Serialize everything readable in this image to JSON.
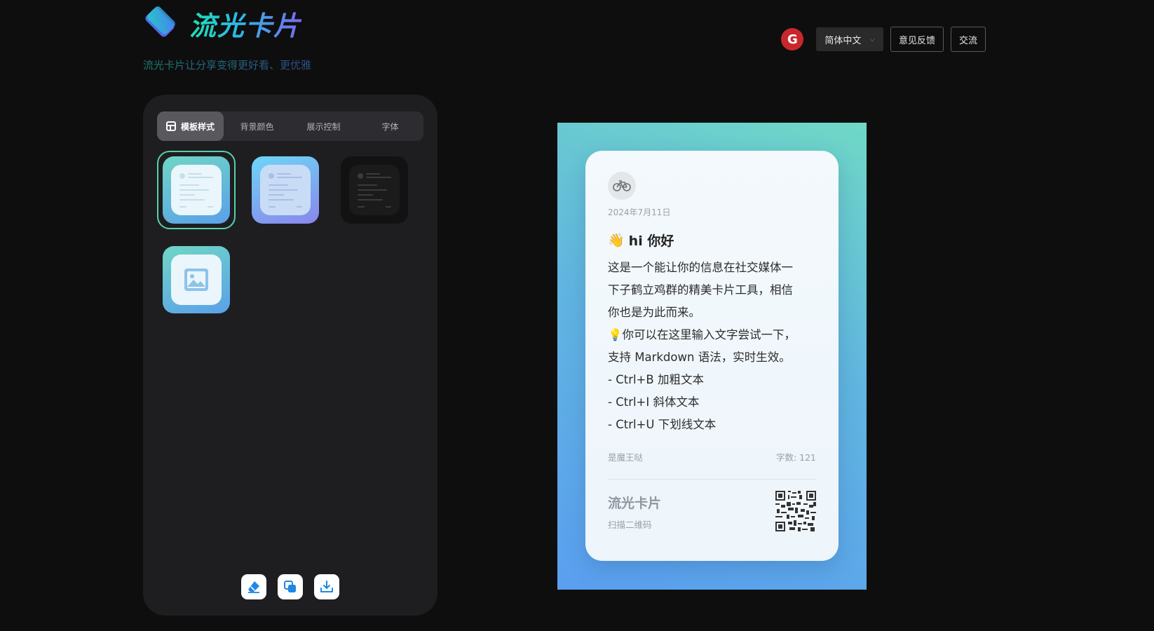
{
  "brand": {
    "title": "流光卡片",
    "slogan": "流光卡片让分享变得更好看、更优雅"
  },
  "topbar": {
    "logo_letter": "G",
    "language": "简体中文",
    "feedback_label": "意见反馈",
    "community_label": "交流"
  },
  "tabs": [
    {
      "label": "模板样式",
      "active": true
    },
    {
      "label": "背景颜色",
      "active": false
    },
    {
      "label": "展示控制",
      "active": false
    },
    {
      "label": "字体",
      "active": false
    }
  ],
  "templates": [
    {
      "name": "light-gradient",
      "selected": true
    },
    {
      "name": "purple-gradient",
      "selected": false
    },
    {
      "name": "dark",
      "selected": false
    },
    {
      "name": "image",
      "selected": false
    }
  ],
  "actions": [
    {
      "icon": "eraser-icon"
    },
    {
      "icon": "copy-icon"
    },
    {
      "icon": "download-icon"
    }
  ],
  "card": {
    "avatar_icon": "bicycle-icon",
    "date": "2024年7月11日",
    "heading_emoji": "👋",
    "heading": "hi 你好",
    "body_lines": [
      "这是一个能让你的信息在社交媒体一",
      "下子鹤立鸡群的精美卡片工具，相信",
      "你也是为此而来。",
      "💡你可以在这里输入文字尝试一下，",
      "支持 Markdown 语法，实时生效。",
      "- Ctrl+B 加粗文本",
      "- Ctrl+I 斜体文本",
      "- Ctrl+U 下划线文本"
    ],
    "author": "是魔王哒",
    "word_count": "字数: 121",
    "footer_title": "流光卡片",
    "footer_sub": "扫描二维码"
  },
  "colors": {
    "accent": "#55d1a8",
    "brand_gradient": [
      "#1ee0b4",
      "#2fb6e6",
      "#7a6af0"
    ],
    "preview_gradient": [
      "#6fd8c6",
      "#61b6e0",
      "#5a9ff0"
    ],
    "action_icon": "#1e88e5"
  }
}
